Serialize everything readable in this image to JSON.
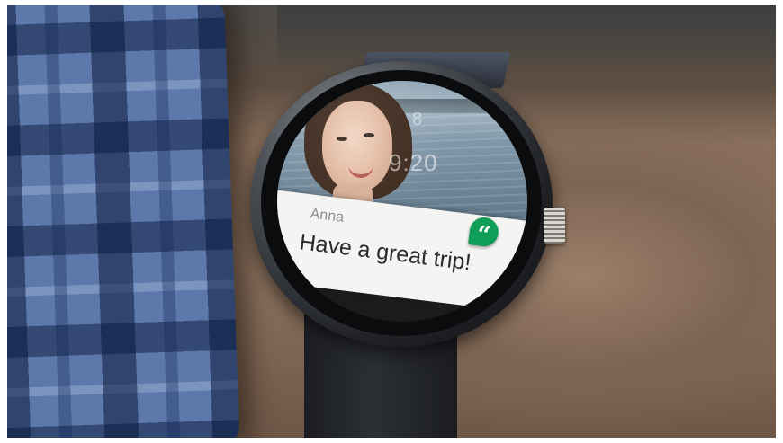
{
  "notification": {
    "sender": "Anna",
    "message": "Have a great trip!",
    "app_icon": "hangouts-quote-icon",
    "accent_color": "#0f9d58"
  },
  "watch_face": {
    "time": "9:20",
    "date": "8"
  }
}
